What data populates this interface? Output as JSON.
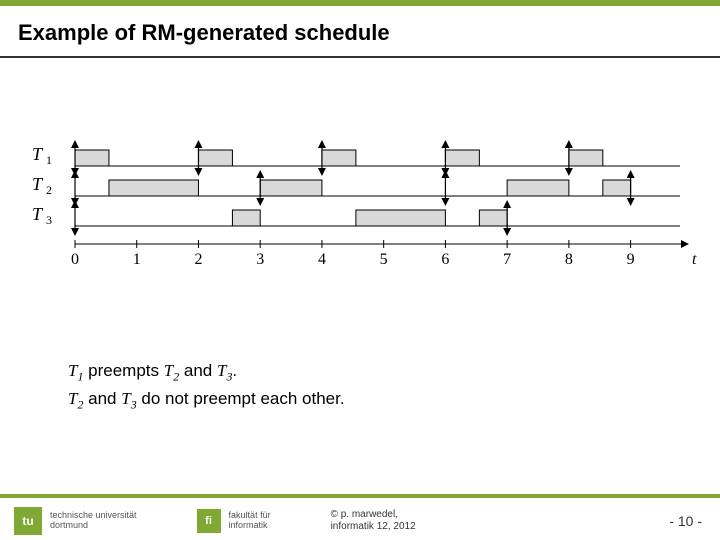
{
  "slide": {
    "title": "Example of RM-generated schedule",
    "caption": {
      "line1_pre": "T",
      "line1_sub1": "1",
      "line1_mid": " preempts ",
      "line1_t2": "T",
      "line1_sub2": "2",
      "line1_and": " and ",
      "line1_t3": "T",
      "line1_sub3": "3",
      "line1_end": ".",
      "line2_t2": "T",
      "line2_sub2": "2",
      "line2_and": " and ",
      "line2_t3": "T",
      "line2_sub3": "3",
      "line2_rest": " do not preempt each other."
    }
  },
  "footer": {
    "uni_line1": "technische universität",
    "uni_line2": "dortmund",
    "fi_line1": "fakultät für",
    "fi_line2": "informatik",
    "tu_mark": "tu",
    "fi_mark": "fi",
    "copyright_line1": "©  p. marwedel,",
    "copyright_line2": "informatik 12,  2012",
    "page": "-  10 -"
  },
  "chart_data": {
    "type": "gantt",
    "time_axis": {
      "min": 0,
      "max": 9.8,
      "ticks": [
        0,
        1,
        2,
        3,
        4,
        5,
        6,
        7,
        8,
        9
      ],
      "label": "t"
    },
    "tasks": [
      {
        "name": "T1",
        "row": 0,
        "period_arrows_at": [
          0,
          2,
          4,
          6,
          8
        ],
        "executions": [
          {
            "start": 0.0,
            "end": 0.55
          },
          {
            "start": 2.0,
            "end": 2.55
          },
          {
            "start": 4.0,
            "end": 4.55
          },
          {
            "start": 6.0,
            "end": 6.55
          },
          {
            "start": 8.0,
            "end": 8.55
          }
        ]
      },
      {
        "name": "T2",
        "row": 1,
        "period_arrows_at": [
          0,
          3,
          6,
          9
        ],
        "executions": [
          {
            "start": 0.55,
            "end": 2.0
          },
          {
            "start": 3.0,
            "end": 4.0
          },
          {
            "start": 7.0,
            "end": 8.0
          },
          {
            "start": 8.55,
            "end": 9.0
          }
        ]
      },
      {
        "name": "T3",
        "row": 2,
        "period_arrows_at": [
          0,
          7
        ],
        "executions": [
          {
            "start": 2.55,
            "end": 3.0
          },
          {
            "start": 4.55,
            "end": 6.0
          },
          {
            "start": 6.55,
            "end": 7.0
          }
        ]
      }
    ]
  }
}
